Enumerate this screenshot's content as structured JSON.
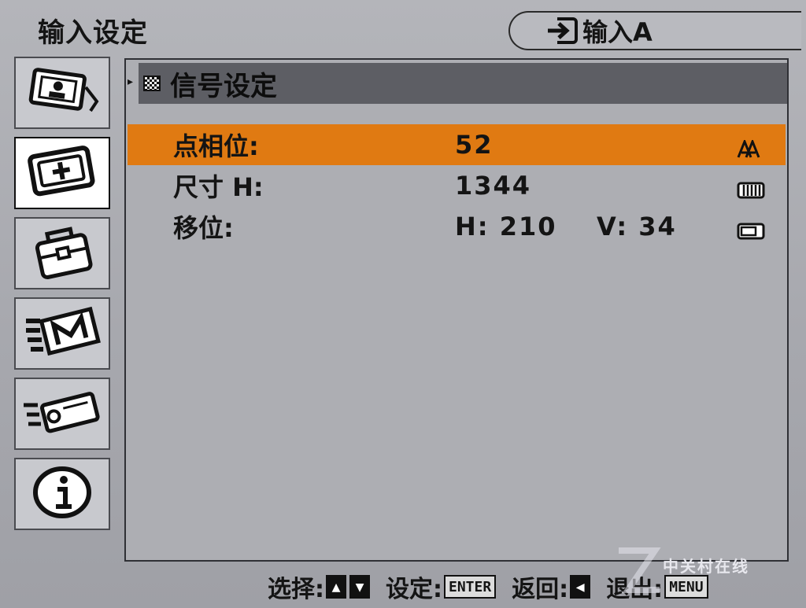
{
  "header": {
    "title": "输入设定",
    "source_label": "输入A",
    "source_icon": "input-arrow-icon"
  },
  "sidebar": {
    "items": [
      {
        "name": "picture-menu",
        "icon": "picture-icon"
      },
      {
        "name": "input-setting-menu",
        "icon": "input-plus-icon",
        "active": true
      },
      {
        "name": "setup-menu",
        "icon": "toolbox-icon"
      },
      {
        "name": "memory-menu",
        "icon": "memory-m-icon"
      },
      {
        "name": "projector-menu",
        "icon": "projector-icon"
      },
      {
        "name": "info-menu",
        "icon": "info-icon"
      }
    ]
  },
  "panel": {
    "title": "信号设定",
    "rows": [
      {
        "label": "点相位:",
        "value": "52",
        "icon": "phase-icon",
        "selected": true
      },
      {
        "label": "尺寸 H:",
        "value": "1344",
        "icon": "size-bars-icon"
      },
      {
        "label": "移位:",
        "value": "H: 210",
        "value2": "V: 34",
        "icon": "shift-icon"
      }
    ]
  },
  "footer": {
    "select_label": "选择:",
    "set_label": "设定:",
    "enter_key": "ENTER",
    "back_label": "返回:",
    "exit_label": "退出:",
    "menu_key": "MENU"
  },
  "watermark": {
    "text": "中关村在线"
  },
  "colors": {
    "selected_row": "#e07a12",
    "header_bar": "#5d5e64"
  }
}
